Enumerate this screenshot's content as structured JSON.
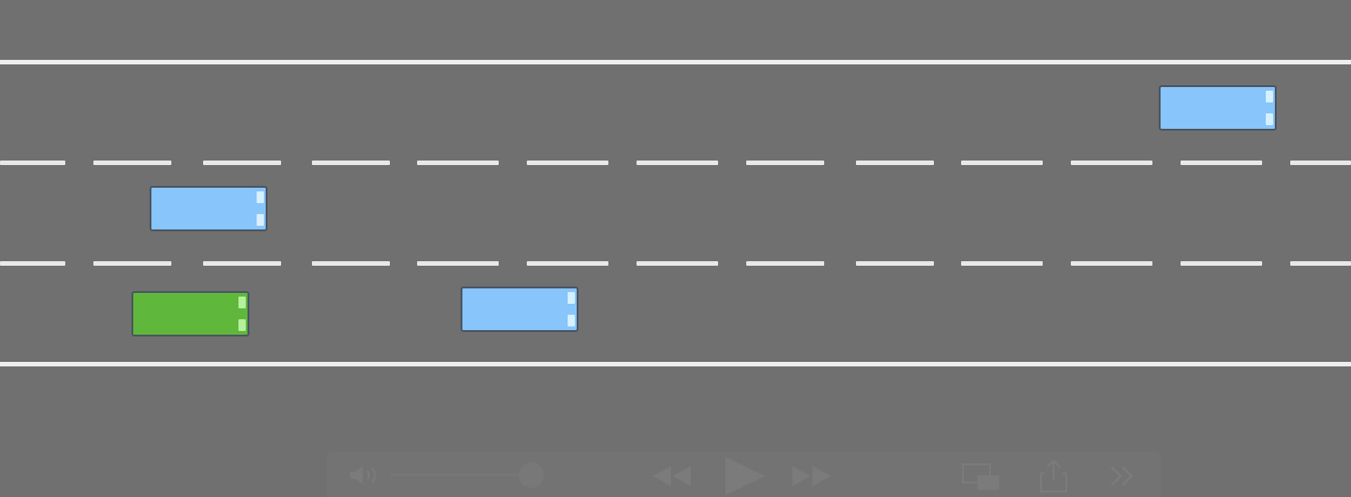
{
  "scene": {
    "road_color": "#707070",
    "lane_count": 3
  },
  "vehicles": [
    {
      "kind": "other-car",
      "lane": 1,
      "color": "#87c5fb",
      "light_color": "#d6f0ff"
    },
    {
      "kind": "other-car",
      "lane": 2,
      "color": "#87c5fb",
      "light_color": "#d6f0ff"
    },
    {
      "kind": "ego-car",
      "lane": 3,
      "color": "#5fb83b",
      "light_color": "#b6f09c"
    },
    {
      "kind": "other-car",
      "lane": 3,
      "color": "#87c5fb",
      "light_color": "#d6f0ff"
    }
  ],
  "player_controls": {
    "volume_icon": "speaker-icon",
    "rewind_icon": "rewind-icon",
    "play_icon": "play-icon",
    "forward_icon": "fast-forward-icon",
    "pip_icon": "picture-in-picture-icon",
    "share_icon": "share-icon",
    "more_icon": "chevron-right-icon"
  }
}
